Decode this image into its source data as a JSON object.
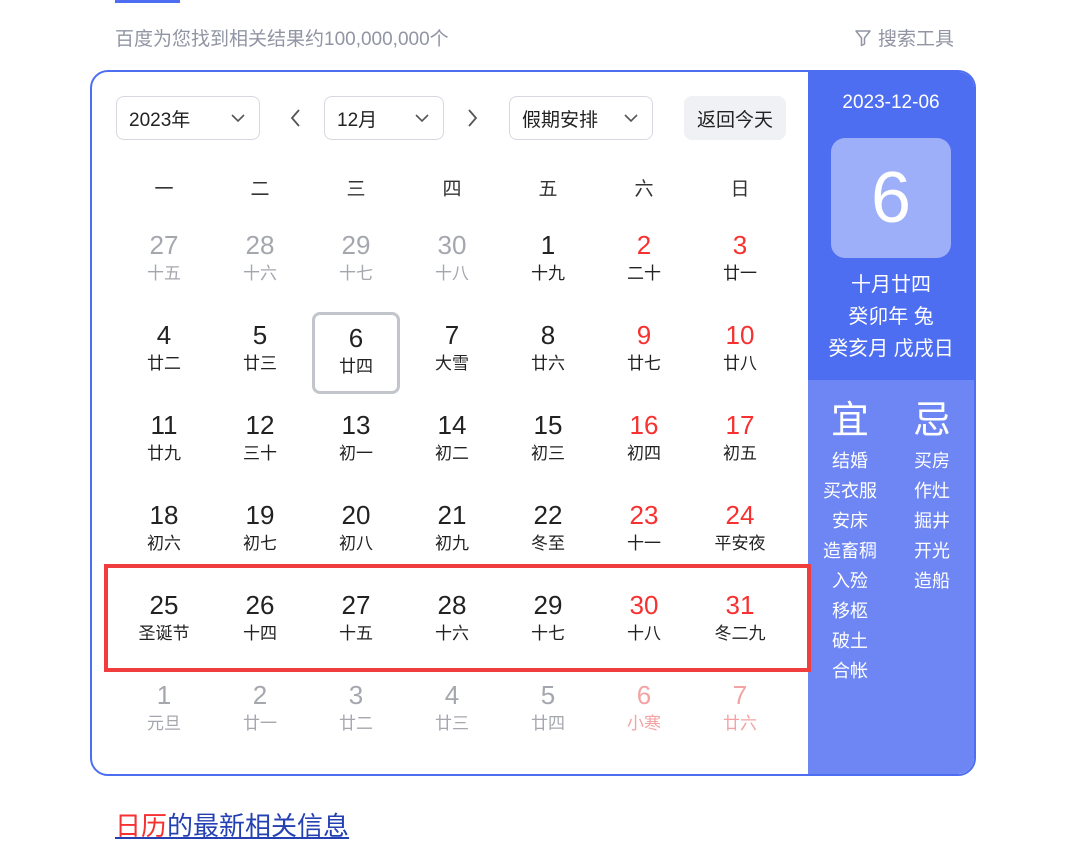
{
  "header": {
    "result_count": "百度为您找到相关结果约100,000,000个",
    "search_tools": "搜索工具",
    "filter_icon": "filter-icon"
  },
  "calendar": {
    "year_select": "2023年",
    "month_select": "12月",
    "holiday_select": "假期安排",
    "today_button": "返回今天",
    "weekdays": [
      "一",
      "二",
      "三",
      "四",
      "五",
      "六",
      "日"
    ],
    "weeks": [
      [
        {
          "d": "27",
          "l": "十五"
        },
        {
          "d": "28",
          "l": "十六"
        },
        {
          "d": "29",
          "l": "十七"
        },
        {
          "d": "30",
          "l": "十八"
        },
        {
          "d": "1",
          "l": "十九"
        },
        {
          "d": "2",
          "l": "二十"
        },
        {
          "d": "3",
          "l": "廿一"
        }
      ],
      [
        {
          "d": "4",
          "l": "廿二"
        },
        {
          "d": "5",
          "l": "廿三"
        },
        {
          "d": "6",
          "l": "廿四"
        },
        {
          "d": "7",
          "l": "大雪"
        },
        {
          "d": "8",
          "l": "廿六"
        },
        {
          "d": "9",
          "l": "廿七"
        },
        {
          "d": "10",
          "l": "廿八"
        }
      ],
      [
        {
          "d": "11",
          "l": "廿九"
        },
        {
          "d": "12",
          "l": "三十"
        },
        {
          "d": "13",
          "l": "初一"
        },
        {
          "d": "14",
          "l": "初二"
        },
        {
          "d": "15",
          "l": "初三"
        },
        {
          "d": "16",
          "l": "初四"
        },
        {
          "d": "17",
          "l": "初五"
        }
      ],
      [
        {
          "d": "18",
          "l": "初六"
        },
        {
          "d": "19",
          "l": "初七"
        },
        {
          "d": "20",
          "l": "初八"
        },
        {
          "d": "21",
          "l": "初九"
        },
        {
          "d": "22",
          "l": "冬至"
        },
        {
          "d": "23",
          "l": "十一"
        },
        {
          "d": "24",
          "l": "平安夜"
        }
      ],
      [
        {
          "d": "25",
          "l": "圣诞节"
        },
        {
          "d": "26",
          "l": "十四"
        },
        {
          "d": "27",
          "l": "十五"
        },
        {
          "d": "28",
          "l": "十六"
        },
        {
          "d": "29",
          "l": "十七"
        },
        {
          "d": "30",
          "l": "十八"
        },
        {
          "d": "31",
          "l": "冬二九"
        }
      ],
      [
        {
          "d": "1",
          "l": "元旦"
        },
        {
          "d": "2",
          "l": "廿一"
        },
        {
          "d": "3",
          "l": "廿二"
        },
        {
          "d": "4",
          "l": "廿三"
        },
        {
          "d": "5",
          "l": "廿四"
        },
        {
          "d": "6",
          "l": "小寒"
        },
        {
          "d": "7",
          "l": "廿六"
        }
      ]
    ],
    "selected_date": "2023-12-06"
  },
  "side": {
    "date": "2023-12-06",
    "big_day": "6",
    "lunar_date": "十月廿四",
    "year_ganzhi": "癸卯年 兔",
    "month_day_ganzhi": "癸亥月 戊戌日",
    "yi_title": "宜",
    "ji_title": "忌",
    "yi": [
      "结婚",
      "买衣服",
      "安床",
      "造畜稠",
      "入殓",
      "移柩",
      "破土",
      "合帐"
    ],
    "ji": [
      "买房",
      "作灶",
      "掘井",
      "开光",
      "造船"
    ]
  },
  "footer": {
    "link_em": "日历",
    "link_rest": "的最新相关信息"
  },
  "colors": {
    "accent": "#4e6ef2",
    "side_bottom": "#6d86f3",
    "weekend": "#f73131",
    "highlight": "#f03d3d"
  }
}
